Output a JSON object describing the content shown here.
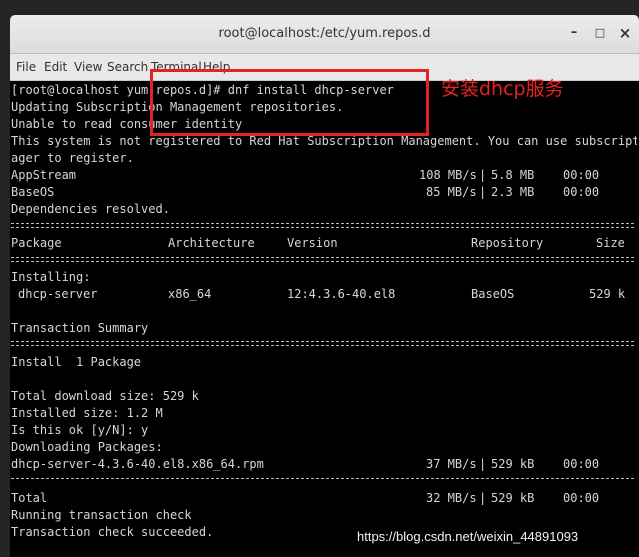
{
  "window": {
    "title": "root@localhost:/etc/yum.repos.d"
  },
  "controls": {
    "minimize": "–",
    "maximize": "□",
    "close": "×"
  },
  "menu": [
    "File",
    "Edit",
    "View",
    "Search",
    "Terminal",
    "Help"
  ],
  "terminal": {
    "lines": [
      "[root@localhost yum.repos.d]# dnf install dhcp-server",
      "Updating Subscription Management repositories.",
      "Unable to read consumer identity",
      "This system is not registered to Red Hat Subscription Management. You can use subscription-man",
      "ager to register."
    ],
    "repos": [
      {
        "name": "AppStream",
        "speed": "108 MB/s",
        "size": "5.8 MB",
        "time": "00:00"
      },
      {
        "name": "BaseOS",
        "speed": "85 MB/s",
        "size": "2.3 MB",
        "time": "00:00"
      }
    ],
    "deps_resolved": "Dependencies resolved.",
    "table_headers": [
      "Package",
      "Architecture",
      "Version",
      "Repository",
      "Size"
    ],
    "installing_label": "Installing:",
    "package_row": {
      "name": "dhcp-server",
      "arch": "x86_64",
      "version": "12:4.3.6-40.el8",
      "repo": "BaseOS",
      "size": "529 k"
    },
    "summary_title": "Transaction Summary",
    "install_line": "Install  1 Package",
    "total_download": "Total download size: 529 k",
    "installed_size": "Installed size: 1.2 M",
    "prompt_ok": "Is this ok [y/N]: y",
    "downloading": "Downloading Packages:",
    "rpm_row": {
      "file": "dhcp-server-4.3.6-40.el8.x86_64.rpm",
      "speed": "37 MB/s",
      "size": "529 kB",
      "time": "00:00"
    },
    "total_row": {
      "label": "Total",
      "speed": "32 MB/s",
      "size": "529 kB",
      "time": "00:00"
    },
    "running_check": "Running transaction check",
    "check_succeeded": "Transaction check succeeded."
  },
  "annotation": {
    "label": "安装dhcp服务",
    "color": "#e52222"
  },
  "watermark": "https://blog.csdn.net/weixin_44891093"
}
